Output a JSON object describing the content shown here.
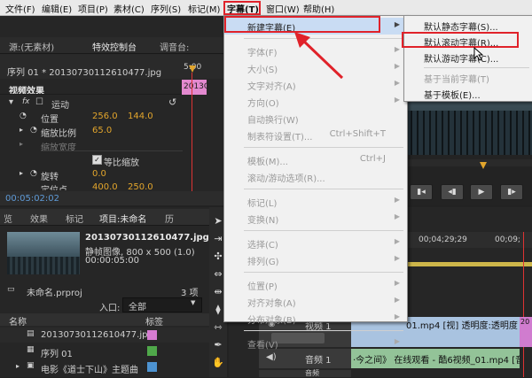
{
  "menubar": {
    "items": [
      "文件(F)",
      "编辑(E)",
      "项目(P)",
      "素材(C)",
      "序列(S)",
      "标记(M)",
      "字幕(T)",
      "窗口(W)",
      "帮助(H)"
    ]
  },
  "source_panel": {
    "tabs": [
      "源:(无素材)",
      "特效控制台",
      "调音台:"
    ],
    "clip": "序列 01 * 20130730112610477.jpg",
    "timecode_top": "5:00",
    "clip_short": "2013C",
    "video_effects": "视频效果",
    "motion": "运动",
    "position_label": "位置",
    "position_x": "256.0",
    "position_y": "144.0",
    "scale_label": "缩放比例",
    "scale_value": "65.0",
    "scale_width_label": "缩放宽度",
    "uniform_scale": "等比缩放",
    "rotation_label": "旋转",
    "rotation_value": "0.0",
    "anchor_label": "定位点",
    "anchor_x": "400.0",
    "anchor_y": "250.0",
    "timecode_bottom": "00:05:02:02"
  },
  "project_panel": {
    "tabs": [
      "览",
      "效果",
      "标记",
      "项目:未命名",
      "历"
    ],
    "file_name": "20130730112610477.jpg",
    "file_type": "静帧图像, 800 x 500 (1.0)",
    "file_duration": "00:00:05:00",
    "project_file": "未命名.prproj",
    "item_count": "3 项",
    "inport_label": "入口:",
    "inport_value": "全部",
    "col_name": "名称",
    "col_label": "标签",
    "items": [
      "20130730112610477.jpg",
      "序列 01",
      "电影《道士下山》主题曲"
    ],
    "item_colors": [
      "#d67bd1",
      "#4fa84a",
      "#4d93d1"
    ]
  },
  "title_menu": {
    "items": [
      {
        "label": "新建字幕(E)",
        "shortcut": "",
        "arrow": true,
        "disabled": false
      },
      {
        "label": "字体(F)",
        "shortcut": "",
        "arrow": true,
        "disabled": true
      },
      {
        "label": "大小(S)",
        "shortcut": "",
        "arrow": true,
        "disabled": true
      },
      {
        "label": "文字对齐(A)",
        "shortcut": "",
        "arrow": true,
        "disabled": true
      },
      {
        "label": "方向(O)",
        "shortcut": "",
        "arrow": true,
        "disabled": true
      },
      {
        "label": "自动换行(W)",
        "shortcut": "",
        "arrow": false,
        "disabled": true
      },
      {
        "label": "制表符设置(T)...",
        "shortcut": "Ctrl+Shift+T",
        "arrow": false,
        "disabled": true
      },
      {
        "label": "模板(M)...",
        "shortcut": "Ctrl+J",
        "arrow": false,
        "disabled": true
      },
      {
        "label": "滚动/游动选项(R)...",
        "shortcut": "",
        "arrow": false,
        "disabled": true
      },
      {
        "label": "标记(L)",
        "shortcut": "",
        "arrow": true,
        "disabled": true
      },
      {
        "label": "变换(N)",
        "shortcut": "",
        "arrow": true,
        "disabled": true
      },
      {
        "label": "选择(C)",
        "shortcut": "",
        "arrow": true,
        "disabled": true
      },
      {
        "label": "排列(G)",
        "shortcut": "",
        "arrow": true,
        "disabled": true
      },
      {
        "label": "位置(P)",
        "shortcut": "",
        "arrow": true,
        "disabled": true
      },
      {
        "label": "对齐对象(A)",
        "shortcut": "",
        "arrow": true,
        "disabled": true
      },
      {
        "label": "分布对象(B)",
        "shortcut": "",
        "arrow": true,
        "disabled": true
      },
      {
        "label": "查看(V)",
        "shortcut": "",
        "arrow": true,
        "disabled": true
      }
    ]
  },
  "submenu": {
    "items": [
      {
        "label": "默认静态字幕(S)...",
        "disabled": false
      },
      {
        "label": "默认滚动字幕(R)...",
        "disabled": false
      },
      {
        "label": "默认游动字幕(C)...",
        "disabled": false
      },
      {
        "label": "基于当前字幕(T)",
        "disabled": true
      },
      {
        "label": "基于模板(E)...",
        "disabled": false
      }
    ]
  },
  "timeline": {
    "ruler_1": "00;04;29;29",
    "ruler_2": "00;09;",
    "track_video": "视频 1",
    "track_audio": "音频 1",
    "track_audio2": "音频",
    "video_clip": "01.mp4 [视] 透明度:透明度",
    "audio_clip": "·今之间》 在线观看 - 酷6视频_01.mp4 [音]",
    "clip_video_start": "20"
  },
  "colors": {
    "accent": "#e0222a",
    "value": "#e2a52c",
    "menubg": "#f1f1f1",
    "highlight": "#c9dcf3"
  }
}
